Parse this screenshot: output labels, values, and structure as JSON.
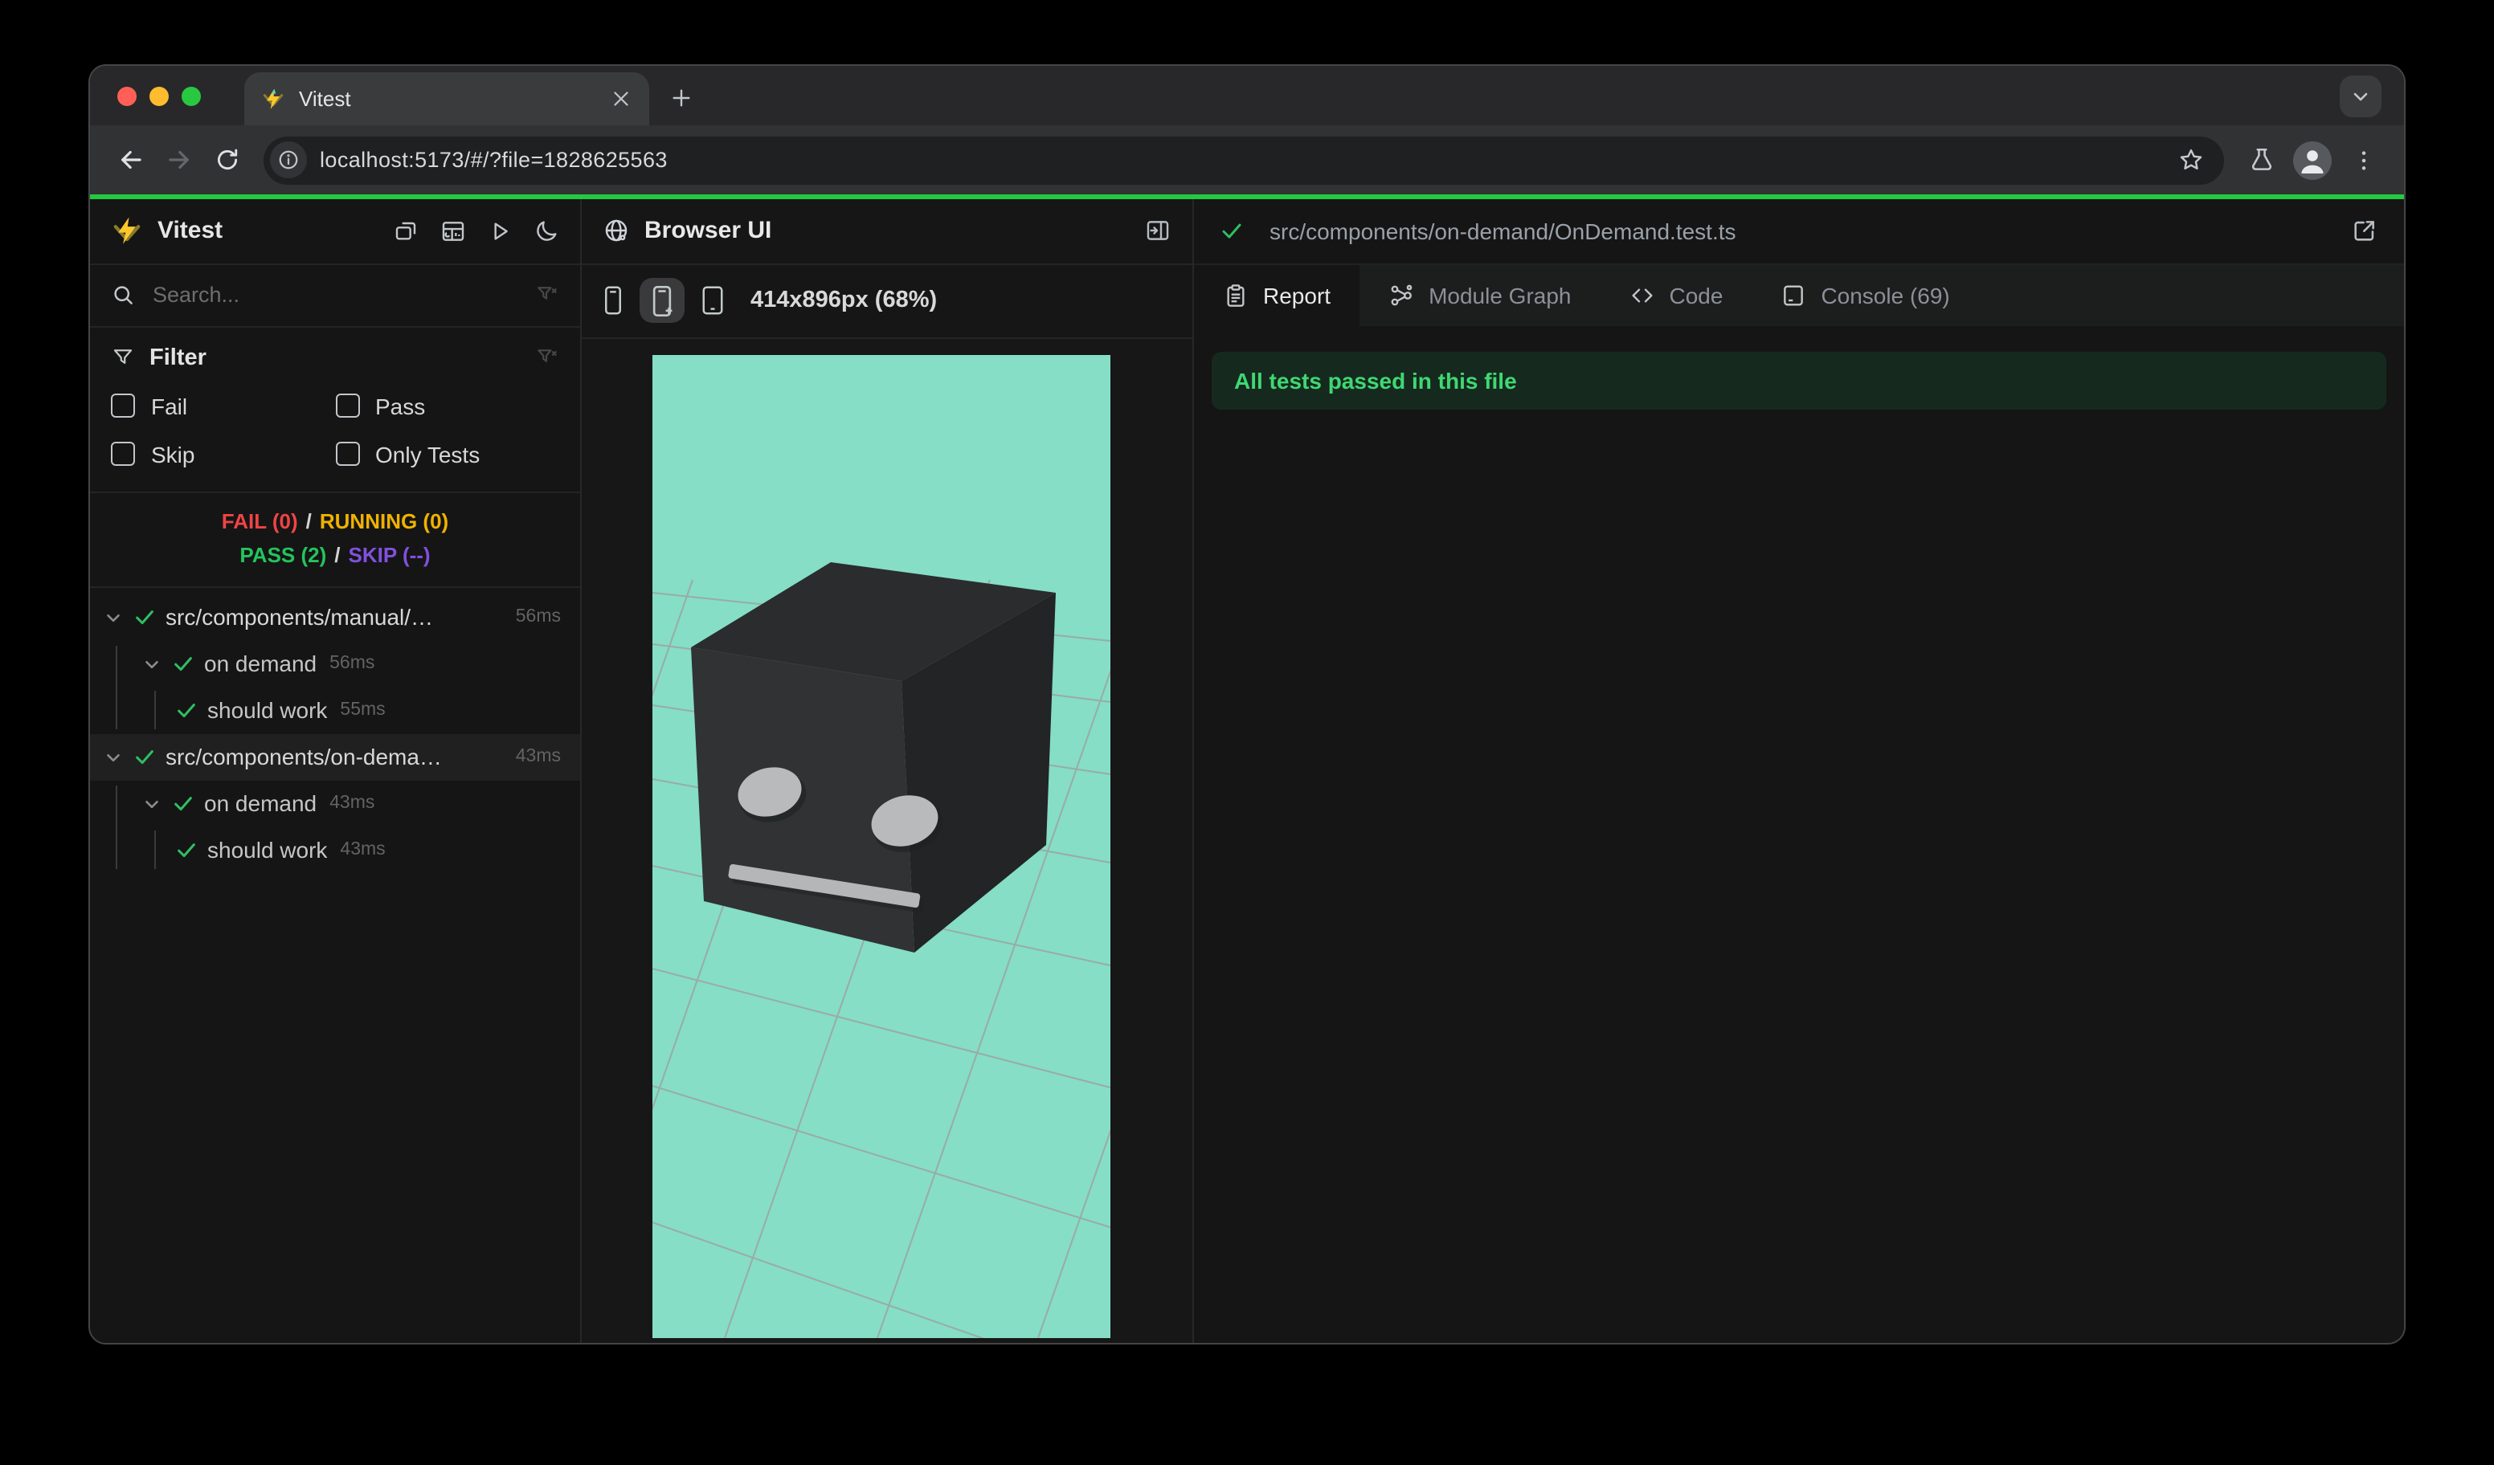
{
  "browser_chrome": {
    "tab_title": "Vitest",
    "url": "localhost:5173/#/?file=1828625563"
  },
  "vitest_sidebar": {
    "title": "Vitest",
    "search_placeholder": "Search...",
    "filter_title": "Filter",
    "filter_options": {
      "fail": "Fail",
      "pass": "Pass",
      "skip": "Skip",
      "only_tests": "Only Tests"
    },
    "summary": {
      "fail": "FAIL (0)",
      "running": "RUNNING (0)",
      "pass": "PASS (2)",
      "skip": "SKIP (--)",
      "separator": "/"
    },
    "tree": [
      {
        "label": "src/components/manual/…",
        "duration": "56ms"
      },
      {
        "label": "on demand",
        "duration": "56ms"
      },
      {
        "label": "should work",
        "duration": "55ms"
      },
      {
        "label": "src/components/on-dema…",
        "duration": "43ms"
      },
      {
        "label": "on demand",
        "duration": "43ms"
      },
      {
        "label": "should work",
        "duration": "43ms"
      }
    ]
  },
  "browser_ui_panel": {
    "title": "Browser UI",
    "viewport_size_label": "414x896px (68%)"
  },
  "report_panel": {
    "file_path": "src/components/on-demand/OnDemand.test.ts",
    "tabs": [
      {
        "label": "Report"
      },
      {
        "label": "Module Graph"
      },
      {
        "label": "Code"
      },
      {
        "label": "Console (69)"
      }
    ],
    "banner_text": "All tests passed in this file"
  },
  "colors": {
    "progress_green": "#23c93f",
    "fail_red": "#ef4444",
    "running_yellow": "#f0b100",
    "pass_green": "#24c45c",
    "skip_purple": "#8250df",
    "banner_bg": "#16291e",
    "banner_text_green": "#3fd873",
    "scene_background": "#85dec5"
  }
}
